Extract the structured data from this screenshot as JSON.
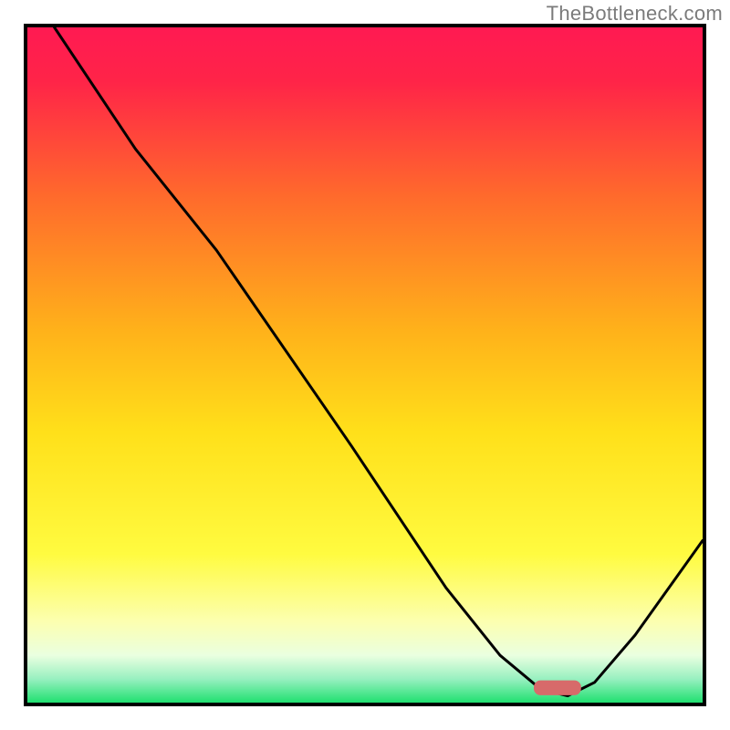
{
  "watermark": "TheBottleneck.com",
  "chart_data": {
    "type": "line",
    "title": "",
    "xlabel": "",
    "ylabel": "",
    "axis_visible": false,
    "xlim": [
      0,
      100
    ],
    "ylim": [
      0,
      100
    ],
    "background_gradient": {
      "stops": [
        {
          "offset": 0,
          "color": "#ff1a52"
        },
        {
          "offset": 0.08,
          "color": "#ff2448"
        },
        {
          "offset": 0.25,
          "color": "#ff6a2c"
        },
        {
          "offset": 0.45,
          "color": "#ffb21a"
        },
        {
          "offset": 0.6,
          "color": "#ffe01a"
        },
        {
          "offset": 0.78,
          "color": "#fffb40"
        },
        {
          "offset": 0.88,
          "color": "#fcffb0"
        },
        {
          "offset": 0.93,
          "color": "#eaffe0"
        },
        {
          "offset": 0.965,
          "color": "#98f0c0"
        },
        {
          "offset": 1.0,
          "color": "#20e070"
        }
      ]
    },
    "curve": {
      "points": [
        {
          "x": 4,
          "y": 100
        },
        {
          "x": 16,
          "y": 82
        },
        {
          "x": 24,
          "y": 72
        },
        {
          "x": 28,
          "y": 67
        },
        {
          "x": 48,
          "y": 38
        },
        {
          "x": 62,
          "y": 17
        },
        {
          "x": 70,
          "y": 7
        },
        {
          "x": 76,
          "y": 2
        },
        {
          "x": 80,
          "y": 1
        },
        {
          "x": 84,
          "y": 3
        },
        {
          "x": 90,
          "y": 10
        },
        {
          "x": 100,
          "y": 24
        }
      ]
    },
    "marker": {
      "shape": "rounded-rect",
      "x": 78.5,
      "y": 2.2,
      "w": 7,
      "h": 2.2,
      "fill": "#d76a6a",
      "rx": 1.0
    },
    "border": {
      "width": 4,
      "color": "#000000"
    }
  }
}
